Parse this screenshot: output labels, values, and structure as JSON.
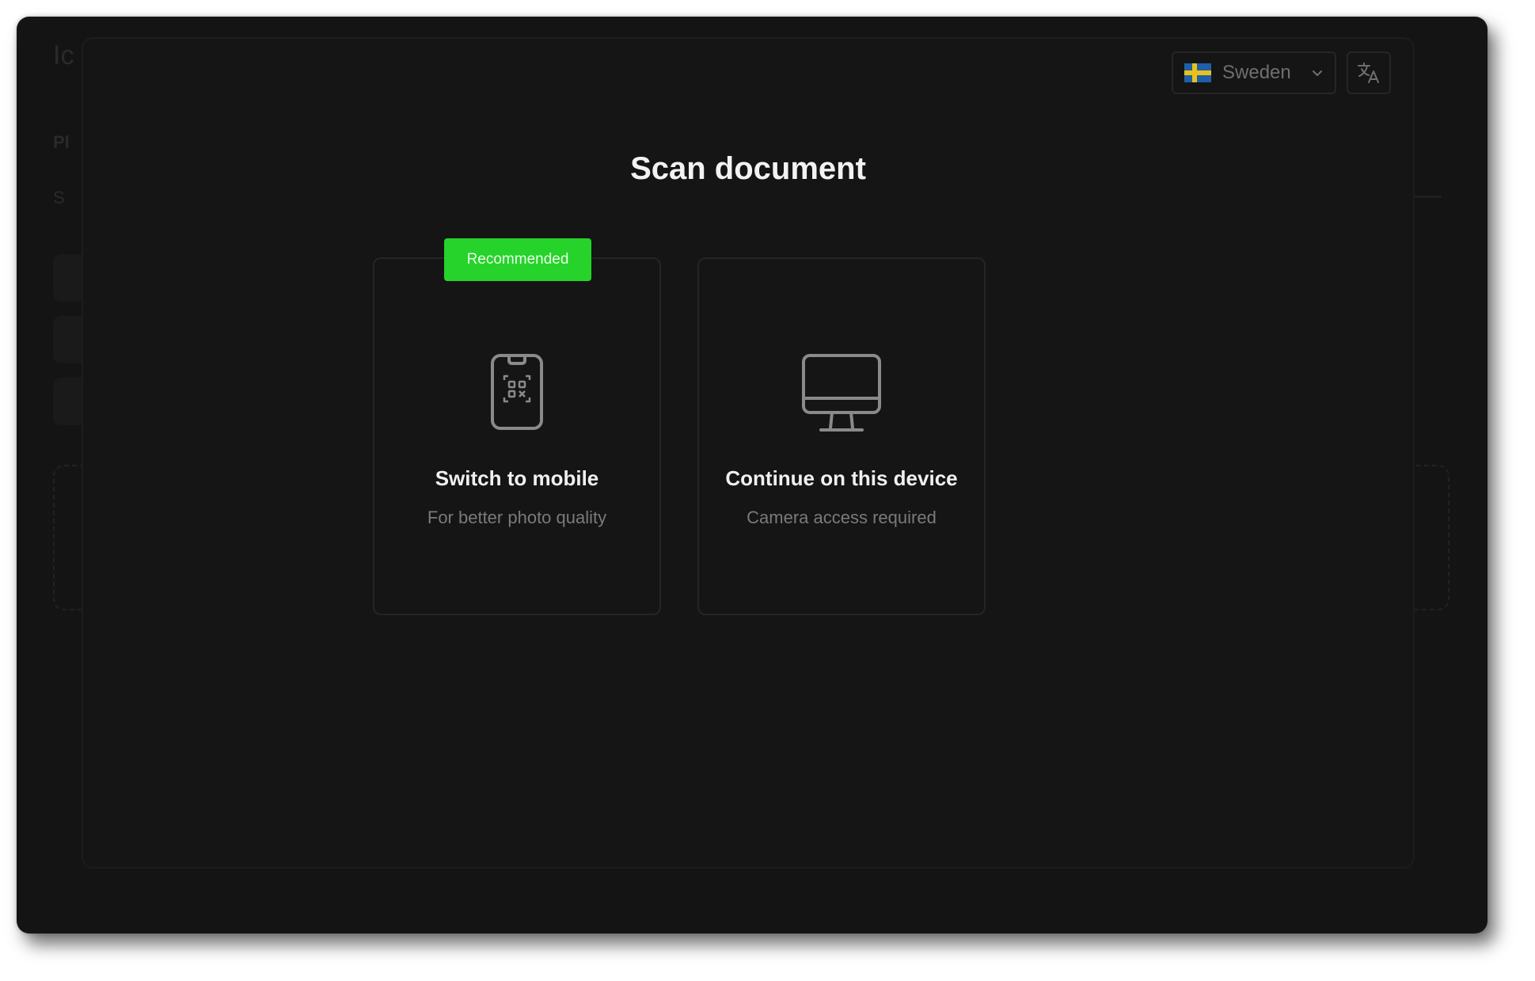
{
  "background_page": {
    "heading_fragment": "Ic",
    "label_fragment_1": "Pl",
    "label_fragment_2": "S"
  },
  "modal": {
    "title": "Scan document",
    "country_select": {
      "value": "Sweden",
      "flag_icon": "sweden-flag-icon",
      "chevron_icon": "chevron-down-icon"
    },
    "language_button": {
      "icon": "translate-icon"
    },
    "options": [
      {
        "badge": "Recommended",
        "icon": "mobile-qr-icon",
        "title": "Switch to mobile",
        "subtitle": "For better photo quality"
      },
      {
        "icon": "desktop-monitor-icon",
        "title": "Continue on this device",
        "subtitle": "Camera access required"
      }
    ]
  },
  "colors": {
    "background": "#141414",
    "badge": "#26d32a",
    "title_text": "#f2f2f2",
    "muted_text": "#7a7a7a"
  }
}
